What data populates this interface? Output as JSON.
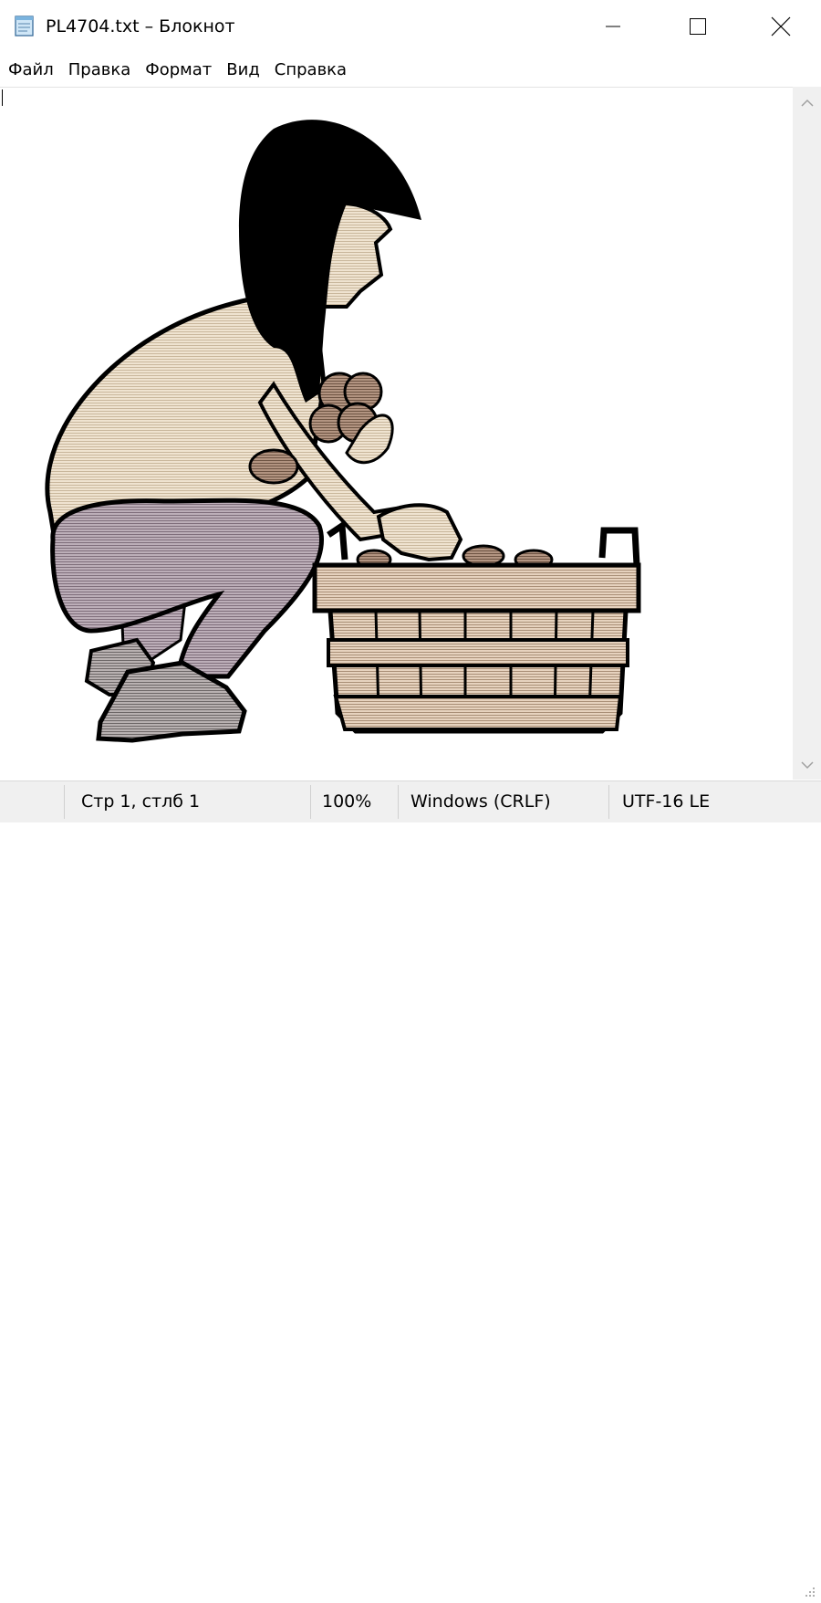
{
  "window": {
    "title": "PL4704.txt – Блокнот",
    "icon": "notepad-icon",
    "controls": [
      "minimize-icon",
      "maximize-icon",
      "close-icon"
    ]
  },
  "menu": {
    "items": [
      "Файл",
      "Правка",
      "Формат",
      "Вид",
      "Справка"
    ]
  },
  "editor": {
    "content": "ASCII-art illustration: woman crouching to pick potatoes into a wooden basket"
  },
  "status": {
    "position": "Стр 1, стлб 1",
    "zoom": "100%",
    "line_ending": "Windows (CRLF)",
    "encoding": "UTF-16 LE"
  },
  "colors": {
    "hair": "#000000",
    "skin": "#eadcc6",
    "trousers": "#b1a3ad",
    "basket": "#d9c3ad",
    "potato": "#a08069"
  }
}
